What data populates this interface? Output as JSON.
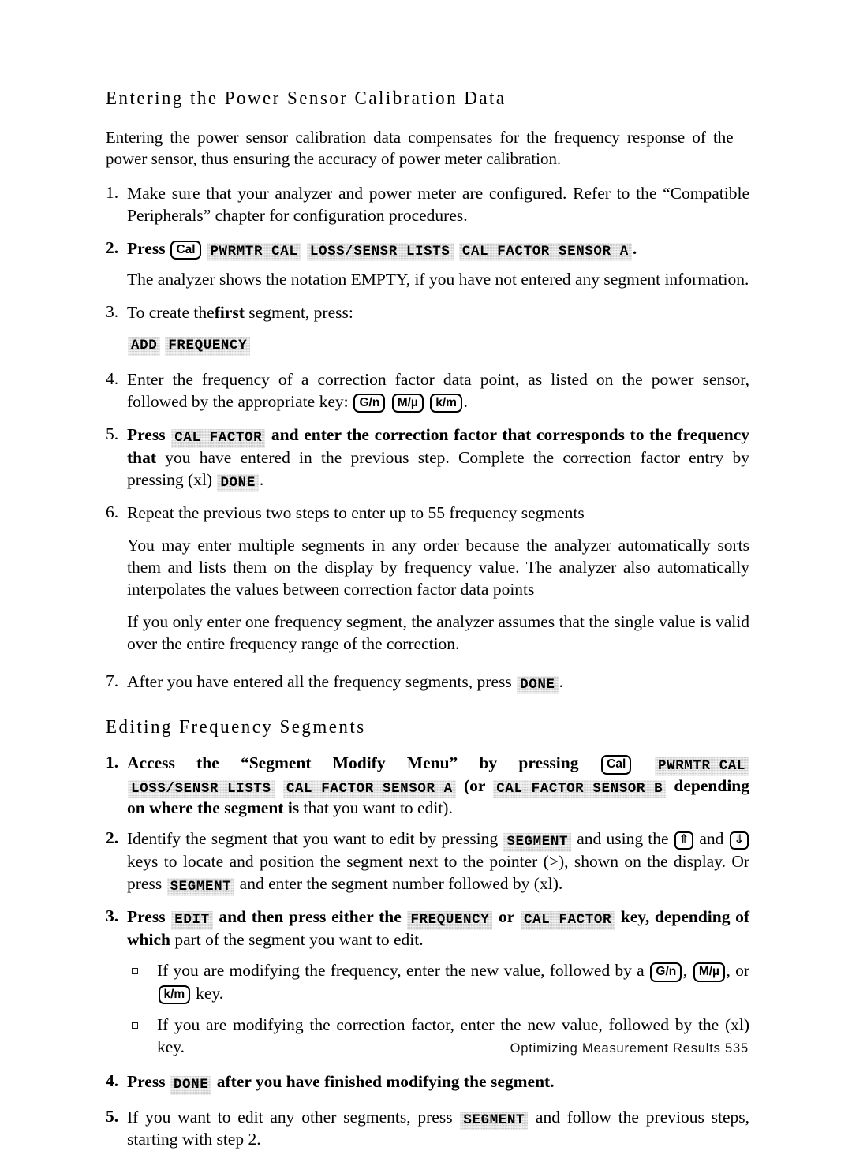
{
  "document": {
    "footer": "Optimizing Measurement Results 535"
  },
  "section1": {
    "heading": "Entering the Power Sensor Calibration Data",
    "intro": "Entering the power sensor calibration data compensates for the frequency response of the power sensor, thus ensuring the accuracy of power meter calibration.",
    "steps": {
      "n1": "1.",
      "s1_text": "Make sure that your analyzer and power meter are configured. Refer to the “Compatible Peripherals” chapter for configuration procedures.",
      "n2": "2.",
      "s2_press": "Press",
      "s2_key_cal": "Cal",
      "s2_sk1": "PWRMTR CAL",
      "s2_sk2": "LOSS/SENSR LISTS",
      "s2_sk3": "CAL FACTOR SENSOR A",
      "s2_period": ".",
      "s2_note": "The analyzer shows the notation EMPTY, if you have not entered any segment information.",
      "n3": "3.",
      "s3_a": "To create the",
      "s3_bold": "first",
      "s3_b": " segment, press:",
      "s3_sk1": "ADD",
      "s3_sk2": "FREQUENCY",
      "n4": "4.",
      "s4_a": "Enter the frequency of a correction factor data point, as listed on the power sensor, followed by the appropriate key:",
      "s4_key1": "G/n",
      "s4_key2": "M/µ",
      "s4_key3": "k/m",
      "s4_end": ".",
      "n5": "5.",
      "s5_press": "Press",
      "s5_sk1": "CAL FACTOR",
      "s5_bold_rest": "and enter the correction factor that corresponds to the frequency that",
      "s5_plain": "you have entered in the previous step. Complete the correction factor entry by pressing (xl)",
      "s5_sk2": "DONE",
      "s5_period": ".",
      "n6": "6.",
      "s6_text": "Repeat the previous two steps to enter up to 55 frequency segments",
      "s6_p1": "You may enter multiple segments in any order because the analyzer automatically sorts them and lists them on the display by frequency value. The analyzer also automatically interpolates the values between correction factor data points",
      "s6_p2": "If you only enter one frequency segment, the analyzer assumes that the single value is valid over the entire frequency range of the correction.",
      "n7": "7.",
      "s7_a": "After you have entered all the frequency segments, press",
      "s7_sk1": "DONE",
      "s7_end": "."
    }
  },
  "section2": {
    "heading": "Editing Frequency Segments",
    "steps": {
      "n1": "1.",
      "e1_a": "Access the “Segment Modify Menu” by pressing",
      "e1_key_cal": "Cal",
      "e1_sk1": "PWRMTR CAL",
      "e1_sk2": "LOSS/SENSR LISTS",
      "e1_sk3": "CAL FACTOR SENSOR A",
      "e1_or": "(or",
      "e1_sk4": "CAL FACTOR SENSOR B",
      "e1_b": "depending on where the segment is",
      "e1_c": "that you want to edit).",
      "n2": "2.",
      "e2_a": "Identify the segment that you want to edit by pressing",
      "e2_sk1": "SEGMENT",
      "e2_b": "and using the",
      "e2_key_up": "⇑",
      "e2_c": "and",
      "e2_key_down": "⇓",
      "e2_d": "keys to locate and position the segment next to the pointer (>), shown on the display. Or press",
      "e2_sk2": "SEGMENT",
      "e2_e": "and enter the segment number followed by (xl).",
      "n3": "3.",
      "e3_press": "Press",
      "e3_sk1": "EDIT",
      "e3_a": "and then press either the",
      "e3_sk2": "FREQUENCY",
      "e3_or": "or",
      "e3_sk3": "CAL FACTOR",
      "e3_b": "key, depending of which",
      "e3_c": "part of the segment you want to edit.",
      "b1_a": "If you are modifying the frequency, enter the new value, followed by a",
      "b1_key1": "G/n",
      "b1_comma": ",",
      "b1_key2": "M/µ",
      "b1_b": ", or",
      "b1_key3": "k/m",
      "b1_c": "key.",
      "b2_a": "If you are modifying the correction factor, enter the new value, followed by the (xl) key.",
      "n4": "4.",
      "e4_press": "Press",
      "e4_sk1": "DONE",
      "e4_a": "after you have finished modifying the segment.",
      "n5": "5.",
      "e5_a": "If you want to edit any other segments, press",
      "e5_sk1": "SEGMENT",
      "e5_b": "and follow the previous steps, starting with step 2."
    }
  }
}
